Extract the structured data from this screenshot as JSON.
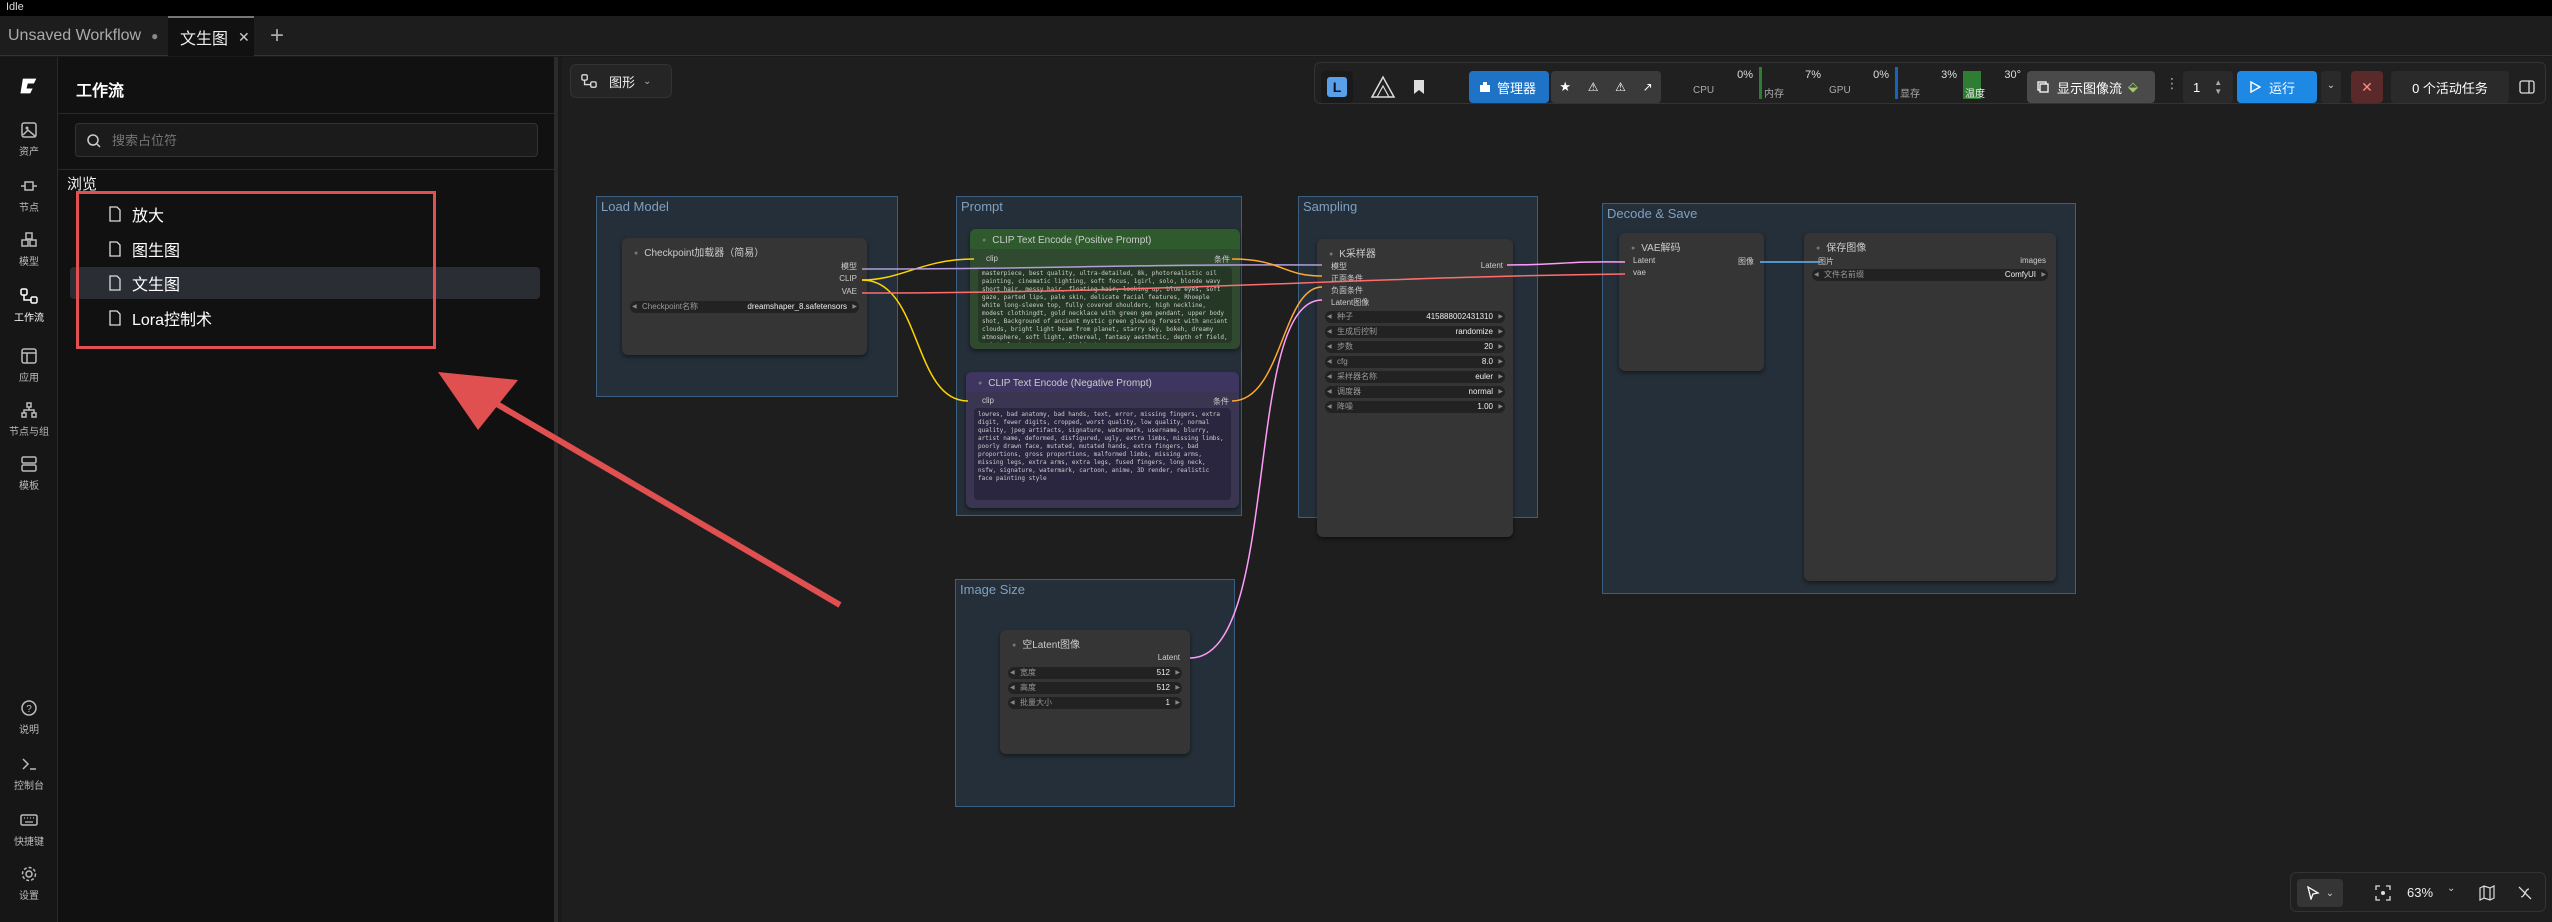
{
  "status": {
    "text": "Idle"
  },
  "tabs": [
    {
      "label": "Unsaved Workflow",
      "modified": "●"
    },
    {
      "label": "文生图",
      "close": "✕"
    }
  ],
  "new_tab": "+",
  "sidebar": {
    "items": [
      {
        "label": "资产",
        "icon": "image-icon"
      },
      {
        "label": "节点",
        "icon": "node-icon"
      },
      {
        "label": "模型",
        "icon": "cube-icon"
      },
      {
        "label": "工作流",
        "icon": "workflow-icon"
      },
      {
        "label": "应用",
        "icon": "app-icon"
      },
      {
        "label": "节点与组",
        "icon": "tree-icon"
      },
      {
        "label": "模板",
        "icon": "template-icon"
      },
      {
        "label": "说明",
        "icon": "help-icon"
      },
      {
        "label": "控制台",
        "icon": "terminal-icon"
      },
      {
        "label": "快捷键",
        "icon": "keyboard-icon"
      },
      {
        "label": "设置",
        "icon": "gear-icon"
      }
    ]
  },
  "panel": {
    "title": "工作流",
    "search_placeholder": "搜索占位符",
    "section": "浏览",
    "workflows": [
      "放大",
      "图生图",
      "文生图",
      "Lora控制术"
    ]
  },
  "canvas_toolbar": {
    "graph_label": "图形",
    "manager_label": "管理器",
    "cpu_label": "CPU",
    "cpu_value": "0%",
    "ram_label": "内存",
    "ram_value": "7%",
    "gpu_label": "GPU",
    "gpu_value": "0%",
    "vram_label": "显存",
    "vram_value": "3%",
    "temp_label": "温度",
    "temp_value": "30°",
    "image_feed_label": "显示图像流",
    "batch_count": "1",
    "run_label": "运行",
    "queue_label": "0 个活动任务"
  },
  "groups": {
    "load_model": "Load Model",
    "prompt": "Prompt",
    "sampling": "Sampling",
    "decode_save": "Decode & Save",
    "image_size": "Image Size"
  },
  "nodes": {
    "checkpoint": {
      "title": "Checkpoint加载器（简易）",
      "out_model": "模型",
      "out_clip": "CLIP",
      "out_vae": "VAE",
      "widget_label": "Checkpoint名称",
      "widget_value": "dreamshaper_8.safetensors"
    },
    "clip_pos": {
      "title": "CLIP Text Encode (Positive Prompt)",
      "in_clip": "clip",
      "out": "条件",
      "text": "masterpiece, best quality, ultra-detailed, 8k, photorealistic oil painting, cinematic lighting, soft focus, 1girl, solo, blonde wavy short hair, messy hair, floating hair, looking up, blue eyes, soft gaze, parted lips, pale skin, delicate facial features, Rhoeple white long-sleeve top, fully covered shoulders, high neckline, modest clothingdt, gold necklace with green gem pendant, upper body shot, Background of ancient mystic green glowing forest with ancient clouds, bright light beam from planet, starry sky, bokeh, dreamy atmosphere, soft light, ethereal, fantasy aesthetic, depth of field, painterly texture, smooth skin texture"
    },
    "clip_neg": {
      "title": "CLIP Text Encode (Negative Prompt)",
      "in_clip": "clip",
      "out": "条件",
      "text": "lowres, bad anatomy, bad hands, text, error, missing fingers, extra digit, fewer digits, cropped, worst quality, low quality, normal quality, jpeg artifacts, signature, watermark, username, blurry, artist name, deformed, disfigured, ugly, extra limbs, missing limbs, poorly drawn face, mutated, mutated hands, extra fingers, bad proportions, gross proportions, malformed limbs, missing arms, missing legs, extra arms, extra legs, fused fingers, long neck, nsfw, signature, watermark, cartoon, anime, 3D render, realistic face painting style"
    },
    "ksampler": {
      "title": "K采样器",
      "in_model": "模型",
      "in_pos": "正面条件",
      "in_neg": "负面条件",
      "in_latent": "Latent图像",
      "out": "Latent",
      "widgets": [
        {
          "label": "种子",
          "value": "415888002431310"
        },
        {
          "label": "生成后控制",
          "value": "randomize"
        },
        {
          "label": "步数",
          "value": "20"
        },
        {
          "label": "cfg",
          "value": "8.0"
        },
        {
          "label": "采样器名称",
          "value": "euler"
        },
        {
          "label": "调度器",
          "value": "normal"
        },
        {
          "label": "降噪",
          "value": "1.00"
        }
      ]
    },
    "vae_decode": {
      "title": "VAE解码",
      "in_latent": "Latent",
      "in_vae": "vae",
      "out": "图像"
    },
    "save_image": {
      "title": "保存图像",
      "in_images": "图片",
      "out_images": "images",
      "widget_label": "文件名前缀",
      "widget_value": "ComfyUI"
    },
    "empty_latent": {
      "title": "空Latent图像",
      "out": "Latent",
      "widgets": [
        {
          "label": "宽度",
          "value": "512"
        },
        {
          "label": "高度",
          "value": "512"
        },
        {
          "label": "批量大小",
          "value": "1"
        }
      ]
    }
  },
  "bottom_controls": {
    "zoom": "63%"
  },
  "colors": {
    "accent": "#1e88e5",
    "highlight_box": "#e05050",
    "clip": "#ffd500",
    "vae": "#ff6e6e",
    "latent": "#ff9cf9",
    "model": "#b39ddb",
    "cond": "#ffa931",
    "image": "#64b5f6"
  }
}
